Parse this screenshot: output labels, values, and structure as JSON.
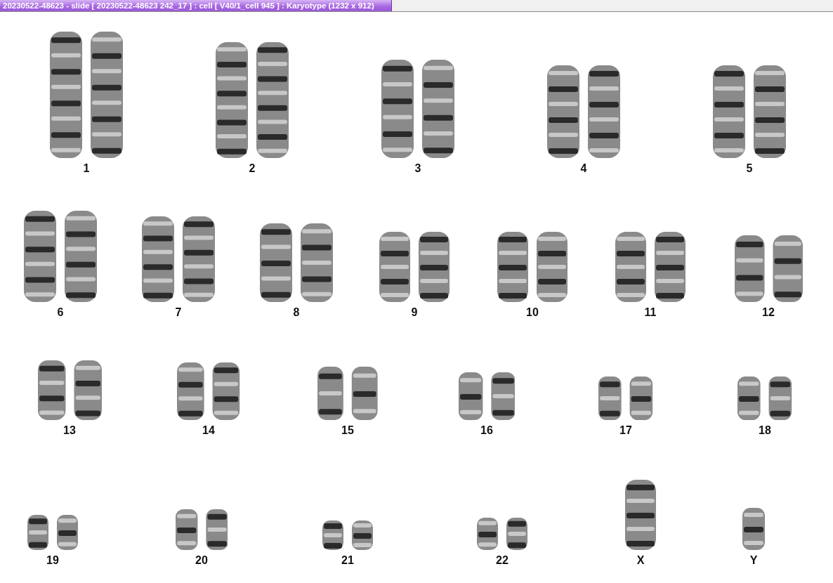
{
  "window": {
    "title": "20230522-48623 - slide [ 20230522-48623 242_17 ] : cell [ V40/1_cell 945 ] : Karyotype  (1232 x 912)"
  },
  "karyotype": {
    "rows": [
      {
        "items": [
          {
            "label": "1",
            "kind": "pair"
          },
          {
            "label": "2",
            "kind": "pair"
          },
          {
            "label": "3",
            "kind": "pair"
          },
          {
            "label": "4",
            "kind": "pair"
          },
          {
            "label": "5",
            "kind": "pair"
          }
        ]
      },
      {
        "items": [
          {
            "label": "6",
            "kind": "pair"
          },
          {
            "label": "7",
            "kind": "pair"
          },
          {
            "label": "8",
            "kind": "pair"
          },
          {
            "label": "9",
            "kind": "pair"
          },
          {
            "label": "10",
            "kind": "pair"
          },
          {
            "label": "11",
            "kind": "pair"
          },
          {
            "label": "12",
            "kind": "pair"
          }
        ]
      },
      {
        "items": [
          {
            "label": "13",
            "kind": "pair"
          },
          {
            "label": "14",
            "kind": "pair"
          },
          {
            "label": "15",
            "kind": "pair"
          },
          {
            "label": "16",
            "kind": "pair"
          },
          {
            "label": "17",
            "kind": "pair"
          },
          {
            "label": "18",
            "kind": "pair"
          }
        ]
      },
      {
        "items": [
          {
            "label": "19",
            "kind": "pair"
          },
          {
            "label": "20",
            "kind": "pair"
          },
          {
            "label": "21",
            "kind": "pair"
          },
          {
            "label": "22",
            "kind": "pair"
          },
          {
            "label": "X",
            "kind": "single"
          },
          {
            "label": "Y",
            "kind": "single"
          }
        ]
      }
    ]
  }
}
